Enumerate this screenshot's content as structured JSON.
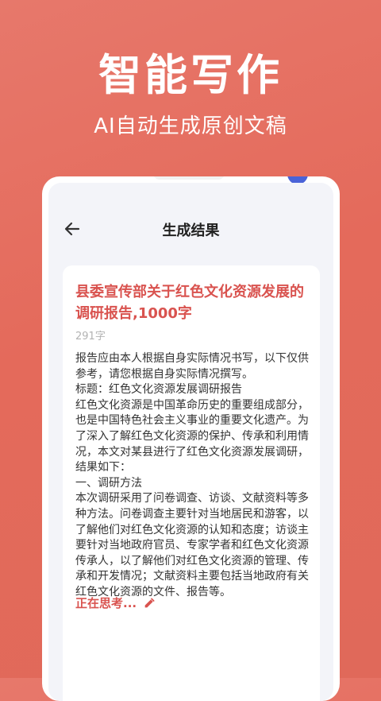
{
  "hero": {
    "title": "智能写作",
    "subtitle": "AI自动生成原创文稿"
  },
  "screen": {
    "nav_title": "生成结果",
    "back_icon": "arrow-left-icon"
  },
  "result": {
    "title": "县委宣传部关于红色文化资源发展的调研报告,1000字",
    "word_count": "291字",
    "body": "报告应由本人根据自身实际情况书写，以下仅供参考，请您根据自身实际情况撰写。\n标题：红色文化资源发展调研报告\n红色文化资源是中国革命历史的重要组成部分，也是中国特色社会主义事业的重要文化遗产。为了深入了解红色文化资源的保护、传承和利用情况，本文对某县进行了红色文化资源发展调研，结果如下：\n一、调研方法\n本次调研采用了问卷调查、访谈、文献资料等多种方法。问卷调查主要针对当地居民和游客，以了解他们对红色文化资源的认知和态度；访谈主要针对当地政府官员、专家学者和红色文化资源传承人，以了解他们对红色文化资源的管理、传承和开发情况；文献资料主要包括当地政府有关红色文化资源的文件、报告等。",
    "status": "正在思考...",
    "status_icon": "pencil-icon"
  },
  "colors": {
    "background": "#e46a5b",
    "accent": "#d9534f"
  }
}
